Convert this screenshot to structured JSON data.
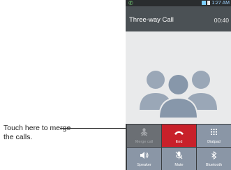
{
  "annotation": {
    "line1": "Touch here to merge",
    "line2": "the calls."
  },
  "status_bar": {
    "time": "1:27 AM"
  },
  "call": {
    "title": "Three-way Call",
    "duration": "00:40"
  },
  "buttons": {
    "merge_call": "Merge call",
    "end": "End",
    "dialpad": "Dialpad",
    "speaker": "Speaker",
    "mute": "Mute",
    "bluetooth": "Bluetooth"
  },
  "icons": {
    "status_left": "phone-call-icon",
    "merge": "merge-call-icon",
    "end": "end-call-icon",
    "dialpad": "dialpad-icon",
    "speaker": "speaker-icon",
    "mute": "mute-mic-icon",
    "bluetooth": "bluetooth-icon",
    "callers": "contacts-group-icon"
  },
  "colors": {
    "end_button": "#c8202a",
    "call_button": "#8a96a6",
    "header": "#4b5155"
  }
}
